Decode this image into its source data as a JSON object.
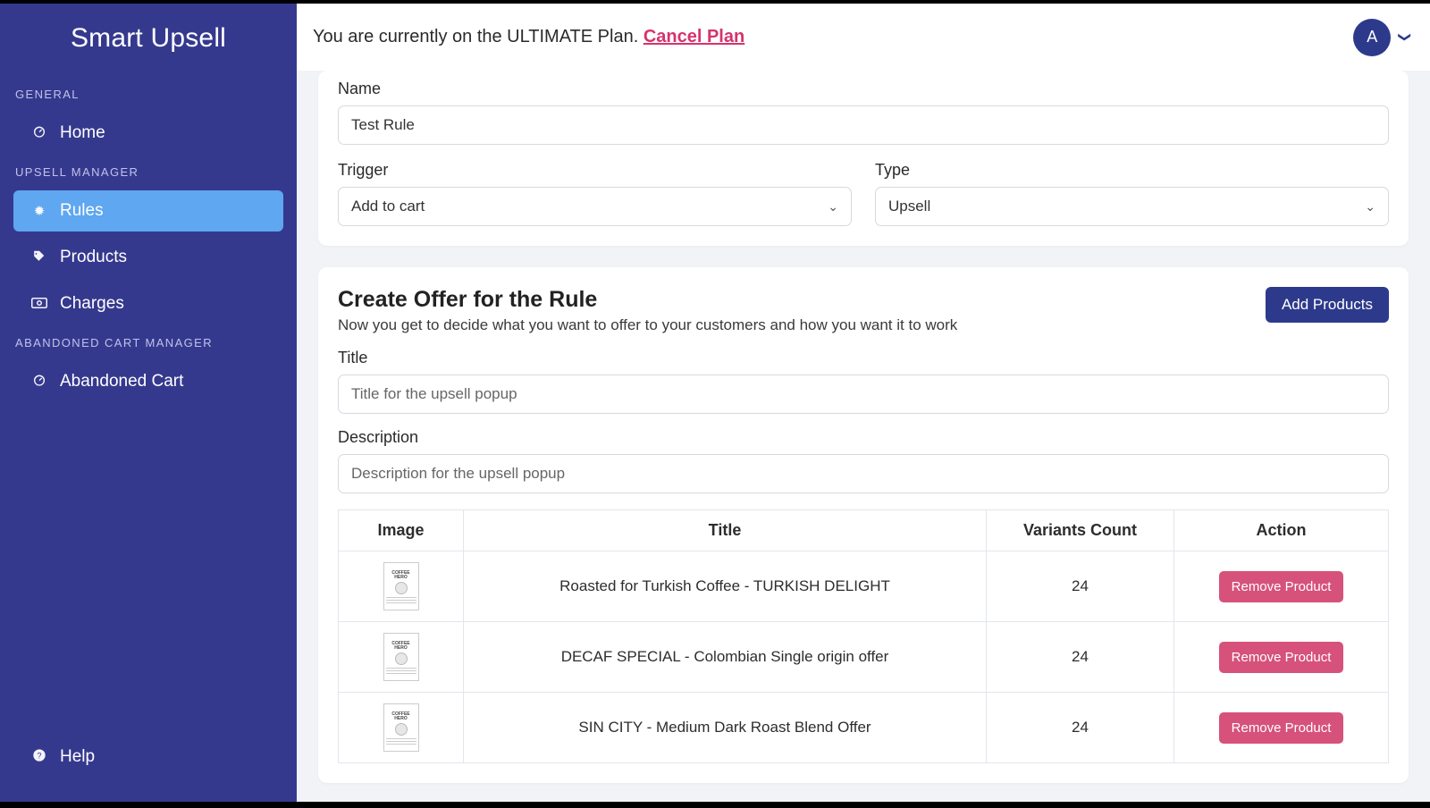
{
  "app_title": "Smart Upsell",
  "sidebar": {
    "sections": [
      {
        "label": "GENERAL",
        "items": [
          {
            "icon": "⛩",
            "label": "Home",
            "active": false
          }
        ]
      },
      {
        "label": "UPSELL MANAGER",
        "items": [
          {
            "icon": "✹",
            "label": "Rules",
            "active": true
          },
          {
            "icon": "🏷",
            "label": "Products",
            "active": false
          },
          {
            "icon": "⊡",
            "label": "Charges",
            "active": false
          }
        ]
      },
      {
        "label": "ABANDONED CART MANAGER",
        "items": [
          {
            "icon": "⛩",
            "label": "Abandoned Cart",
            "active": false
          }
        ]
      }
    ],
    "help": {
      "icon": "?",
      "label": "Help"
    }
  },
  "topbar": {
    "plan_prefix": "You are currently on the ULTIMATE Plan. ",
    "cancel_label": "Cancel Plan",
    "avatar_letter": "A"
  },
  "rule_form": {
    "name_label": "Name",
    "name_value": "Test Rule",
    "trigger_label": "Trigger",
    "trigger_value": "Add to cart",
    "type_label": "Type",
    "type_value": "Upsell"
  },
  "offer": {
    "heading": "Create Offer for the Rule",
    "subheading": "Now you get to decide what you want to offer to your customers and how you want it to work",
    "add_products_label": "Add Products",
    "title_label": "Title",
    "title_placeholder": "Title for the upsell popup",
    "description_label": "Description",
    "description_placeholder": "Description for the upsell popup",
    "table": {
      "headers": {
        "image": "Image",
        "title": "Title",
        "variants": "Variants Count",
        "action": "Action"
      },
      "remove_label": "Remove Product",
      "rows": [
        {
          "title": "Roasted for Turkish Coffee - TURKISH DELIGHT",
          "variants": 24
        },
        {
          "title": "DECAF SPECIAL - Colombian Single origin offer",
          "variants": 24
        },
        {
          "title": "SIN CITY - Medium Dark Roast Blend Offer",
          "variants": 24
        }
      ]
    }
  }
}
